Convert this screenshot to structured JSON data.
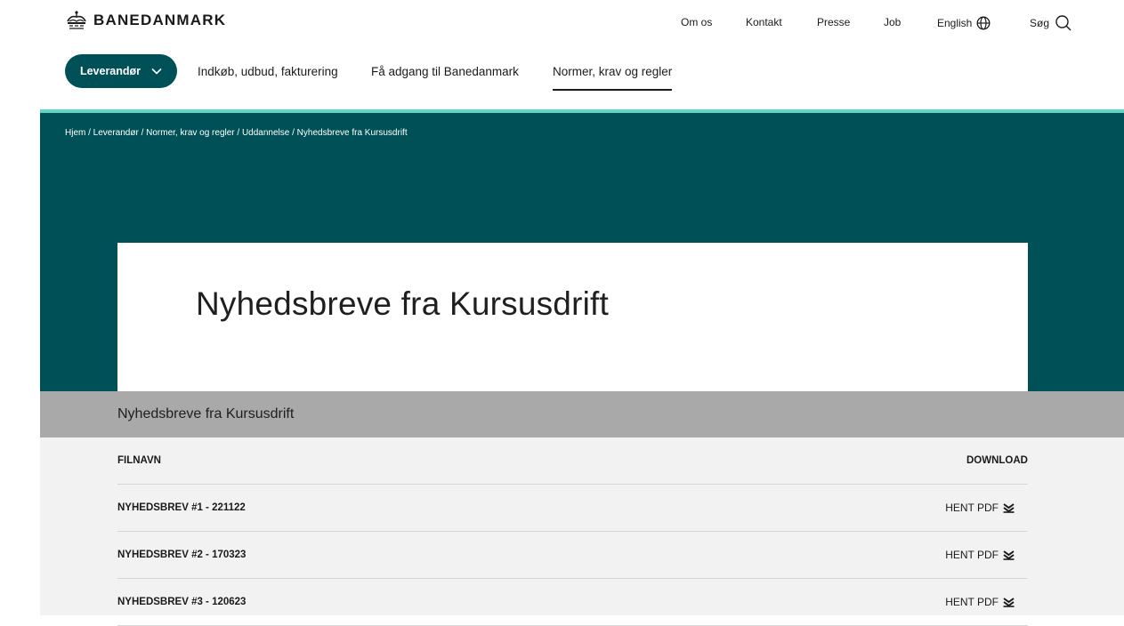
{
  "brand": {
    "name": "BANEDANMARK",
    "logo_icon": "crown-icon"
  },
  "utility_nav": {
    "om_os": "Om os",
    "kontakt": "Kontakt",
    "presse": "Presse",
    "job": "Job",
    "english": "English",
    "search": "Søg"
  },
  "main_nav": {
    "leverandor": "Leverandør",
    "items": [
      "Indkøb, udbud, fakturering",
      "Få adgang til Banedanmark",
      "Normer, krav og regler"
    ],
    "active_item": "Normer, krav og regler"
  },
  "breadcrumb": "Hjem / Leverandør / Normer, krav og regler / Uddannelse / Nyhedsbreve fra Kursusdrift",
  "page_title": "Nyhedsbreve fra Kursusdrift",
  "section_title": "Nyhedsbreve fra Kursusdrift",
  "table": {
    "headers": {
      "name": "FILNAVN",
      "download": "DOWNLOAD"
    },
    "rows": [
      {
        "name": "NYHEDSBREV #1 - 221122",
        "action": "HENT PDF"
      },
      {
        "name": "NYHEDSBREV #2 - 170323",
        "action": "HENT PDF"
      },
      {
        "name": "NYHEDSBREV #3 - 120623",
        "action": "HENT PDF"
      }
    ]
  },
  "colors": {
    "primary": "#005157",
    "accent": "#5fd8c3",
    "section_bar": "#a9a9a9",
    "table_bg": "#f2f2f2"
  }
}
